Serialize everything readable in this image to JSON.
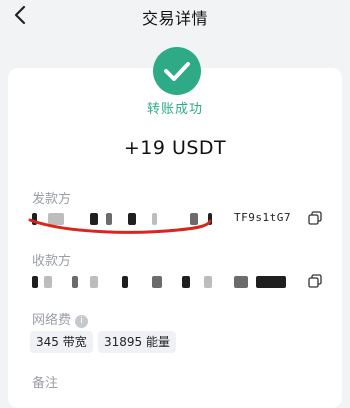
{
  "header": {
    "title": "交易详情"
  },
  "status": {
    "text": "转账成功",
    "accent": "#2eaa86"
  },
  "amount": {
    "text": "+19 USDT"
  },
  "sender": {
    "label": "发款方",
    "address_visible_tail": "TF9s1tG7"
  },
  "receiver": {
    "label": "收款方",
    "address_visible_tail": ""
  },
  "fee": {
    "label": "网络费",
    "info_icon": "info-icon",
    "bandwidth": "345 带宽",
    "energy": "31895 能量"
  },
  "memo": {
    "label": "备注"
  },
  "icons": {
    "back": "chevron-left-icon",
    "status": "check-circle-icon",
    "copy": "copy-icon"
  }
}
